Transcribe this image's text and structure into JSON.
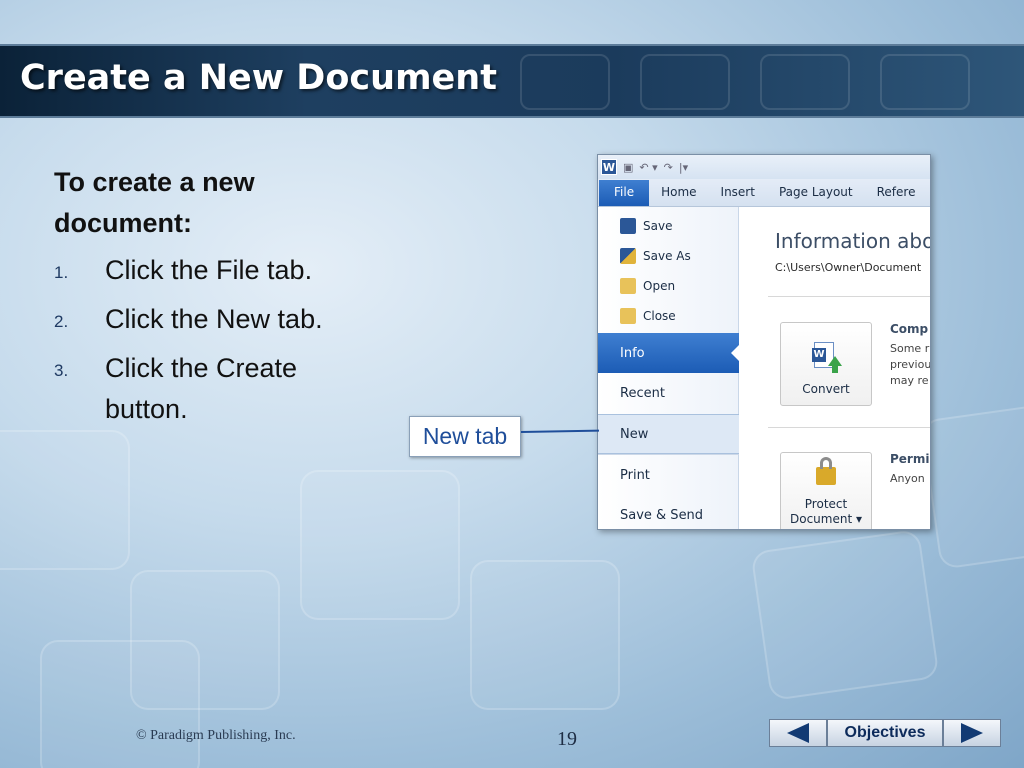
{
  "slide": {
    "title": "Create a New Document",
    "intro": "To create a new document:",
    "steps": [
      {
        "num": "1.",
        "text": "Click the File tab."
      },
      {
        "num": "2.",
        "text": "Click the New tab."
      },
      {
        "num": "3.",
        "text": "Click the Create button."
      }
    ],
    "callout": "New tab",
    "copyright": "© Paradigm Publishing, Inc.",
    "page_number": "19"
  },
  "navigation": {
    "objectives_label": "Objectives",
    "prev_icon": "arrow-left-icon",
    "next_icon": "arrow-right-icon"
  },
  "word_screenshot": {
    "logo": "W",
    "ribbon_tabs": [
      "File",
      "Home",
      "Insert",
      "Page Layout",
      "Refere"
    ],
    "backstage_small": [
      "Save",
      "Save As",
      "Open",
      "Close"
    ],
    "backstage_big": [
      "Info",
      "Recent",
      "New",
      "Print",
      "Save & Send"
    ],
    "info_title": "Information abo",
    "info_path": "C:\\Users\\Owner\\Document",
    "convert_label": "Convert",
    "protect_label_1": "Protect",
    "protect_label_2": "Document ▾",
    "compat_head": "Comp",
    "compat_desc": [
      "Some r",
      "previou",
      "may re"
    ],
    "perm_head": "Permi",
    "perm_desc": "Anyon"
  },
  "colors": {
    "title_bar": "#1e3f60",
    "backstage_accent": "#2b6cc4",
    "callout_text": "#1f4e9a"
  }
}
